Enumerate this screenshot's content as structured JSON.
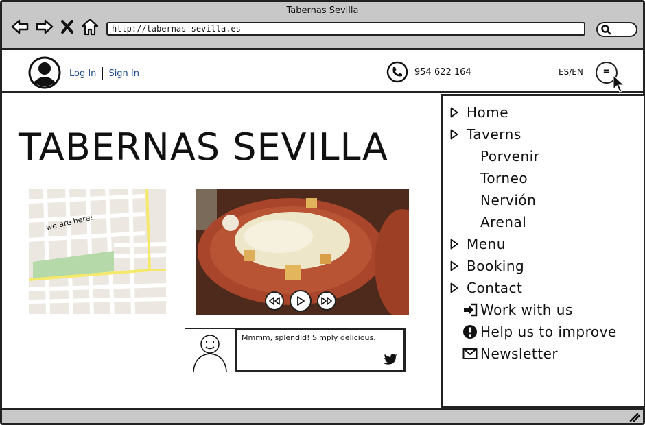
{
  "window": {
    "title": "Tabernas Sevilla"
  },
  "browser": {
    "url": "http://tabernas-sevilla.es",
    "nav_icons": [
      "back-icon",
      "forward-icon",
      "close-icon",
      "home-icon"
    ],
    "search_icon": "search-icon"
  },
  "header": {
    "login_label": "Log In",
    "signin_label": "Sign In",
    "phone": "954 622 164",
    "language": "ES/EN",
    "menu_button": "="
  },
  "main": {
    "title": "TABERNAS SEVILLA",
    "map_label": "we are here!",
    "video_controls": [
      "rewind-icon",
      "play-icon",
      "fast-forward-icon"
    ],
    "comment": "Mmmm, splendid! Simply delicious."
  },
  "sidebar": {
    "primary": [
      {
        "label": "Home"
      },
      {
        "label": "Taverns"
      },
      {
        "label": "Porvenir",
        "sub": true
      },
      {
        "label": "Torneo",
        "sub": true
      },
      {
        "label": "Nervión",
        "sub": true
      },
      {
        "label": "Arenal",
        "sub": true
      },
      {
        "label": "Menu"
      },
      {
        "label": "Booking"
      },
      {
        "label": "Contact"
      }
    ],
    "utility": [
      {
        "label": "Work with us",
        "icon": "sign-in-icon"
      },
      {
        "label": "Help us to improve",
        "icon": "exclamation-icon"
      },
      {
        "label": "Newsletter",
        "icon": "envelope-icon"
      }
    ]
  },
  "colors": {
    "chrome": "#c8c8c8",
    "link": "#1c4a8c",
    "map_road": "#ffffff",
    "map_main_road": "#f4e96a",
    "map_park": "#b5d9a8"
  }
}
